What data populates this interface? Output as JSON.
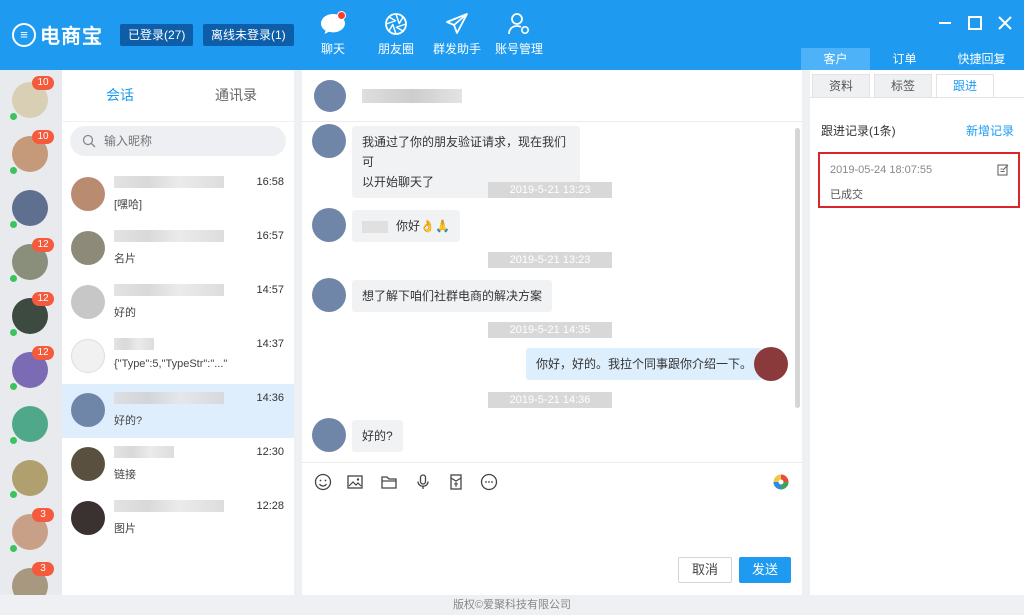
{
  "app": {
    "logo_text": "电商宝",
    "logged_in_label": "已登录(27)",
    "offline_label": "离线未登录(1)"
  },
  "nav": {
    "items": [
      "聊天",
      "朋友圈",
      "群发助手",
      "账号管理"
    ]
  },
  "right_tabs": [
    "客户",
    "订单",
    "快捷回复"
  ],
  "rail": {
    "badges": [
      "10",
      "10",
      "",
      "12",
      "12",
      "12",
      "",
      "",
      "3",
      "3"
    ]
  },
  "contacts": {
    "tabs": [
      "会话",
      "通讯录"
    ],
    "search_placeholder": "输入昵称",
    "items": [
      {
        "time": "16:58",
        "preview": "[嘿哈]"
      },
      {
        "time": "16:57",
        "preview": "名片"
      },
      {
        "time": "14:57",
        "preview": "好的"
      },
      {
        "time": "14:37",
        "preview": "{\"Type\":5,\"TypeStr\":\"...\""
      },
      {
        "time": "14:36",
        "preview": "好的?"
      },
      {
        "time": "12:30",
        "preview": "链接"
      },
      {
        "time": "12:28",
        "preview": "图片"
      }
    ]
  },
  "chat": {
    "messages": [
      {
        "text_line1": "我通过了你的朋友验证请求，现在我们可",
        "text_line2": "以开始聊天了"
      },
      {
        "text": "你好👌🙏"
      },
      {
        "text": "想了解下咱们社群电商的解决方案"
      },
      {
        "text": "你好，好的。我拉个同事跟你介绍一下。"
      },
      {
        "text": "好的?"
      }
    ],
    "timestamps": [
      "2019-5-21 13:23",
      "2019-5-21 13:23",
      "2019-5-21 14:35",
      "2019-5-21 14:36"
    ],
    "cancel_label": "取消",
    "send_label": "发送"
  },
  "panel": {
    "tabs": [
      "资料",
      "标签",
      "跟进"
    ],
    "record_title": "跟进记录(1条)",
    "add_record": "新增记录",
    "record_date": "2019-05-24 18:07:55",
    "record_text": "已成交"
  },
  "footer": "版权©爱聚科技有限公司"
}
